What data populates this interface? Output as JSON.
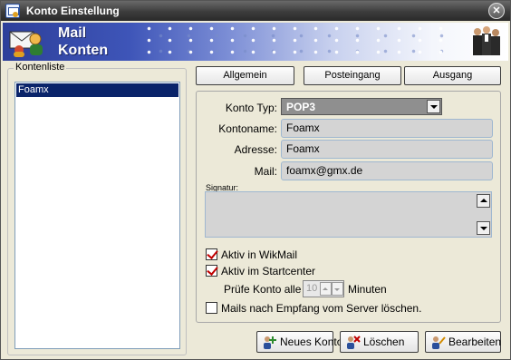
{
  "window": {
    "title": "Konto Einstellung",
    "close_label": "✕"
  },
  "banner": {
    "line1": "Mail",
    "line2": "Konten"
  },
  "account_list": {
    "legend": "Kontenliste",
    "items": [
      "Foamx"
    ]
  },
  "tabs": [
    {
      "label": "Allgemein"
    },
    {
      "label": "Posteingang"
    },
    {
      "label": "Ausgang"
    }
  ],
  "form": {
    "account_type_label": "Konto Typ:",
    "account_type_value": "POP3",
    "account_name_label": "Kontoname:",
    "account_name_value": "Foamx",
    "address_label": "Adresse:",
    "address_value": "Foamx",
    "mail_label": "Mail:",
    "mail_value": "foamx@gmx.de",
    "signature_label": "Signatur:",
    "signature_value": "",
    "active_wikmail_label": "Aktiv in WikMail",
    "active_wikmail_checked": true,
    "active_startcenter_label": "Aktiv im Startcenter",
    "active_startcenter_checked": true,
    "check_interval_label": "Prüfe Konto alle",
    "check_interval_value": "10",
    "check_interval_unit": "Minuten",
    "delete_after_receive_label": "Mails nach Empfang vom Server löschen.",
    "delete_after_receive_checked": false
  },
  "buttons": {
    "new_account": "Neues Konto",
    "delete": "Löschen",
    "edit": "Bearbeiten"
  },
  "colors": {
    "selection": "#0a246a",
    "check_mark": "#c00000",
    "banner_blue": "#2d3f9a"
  }
}
